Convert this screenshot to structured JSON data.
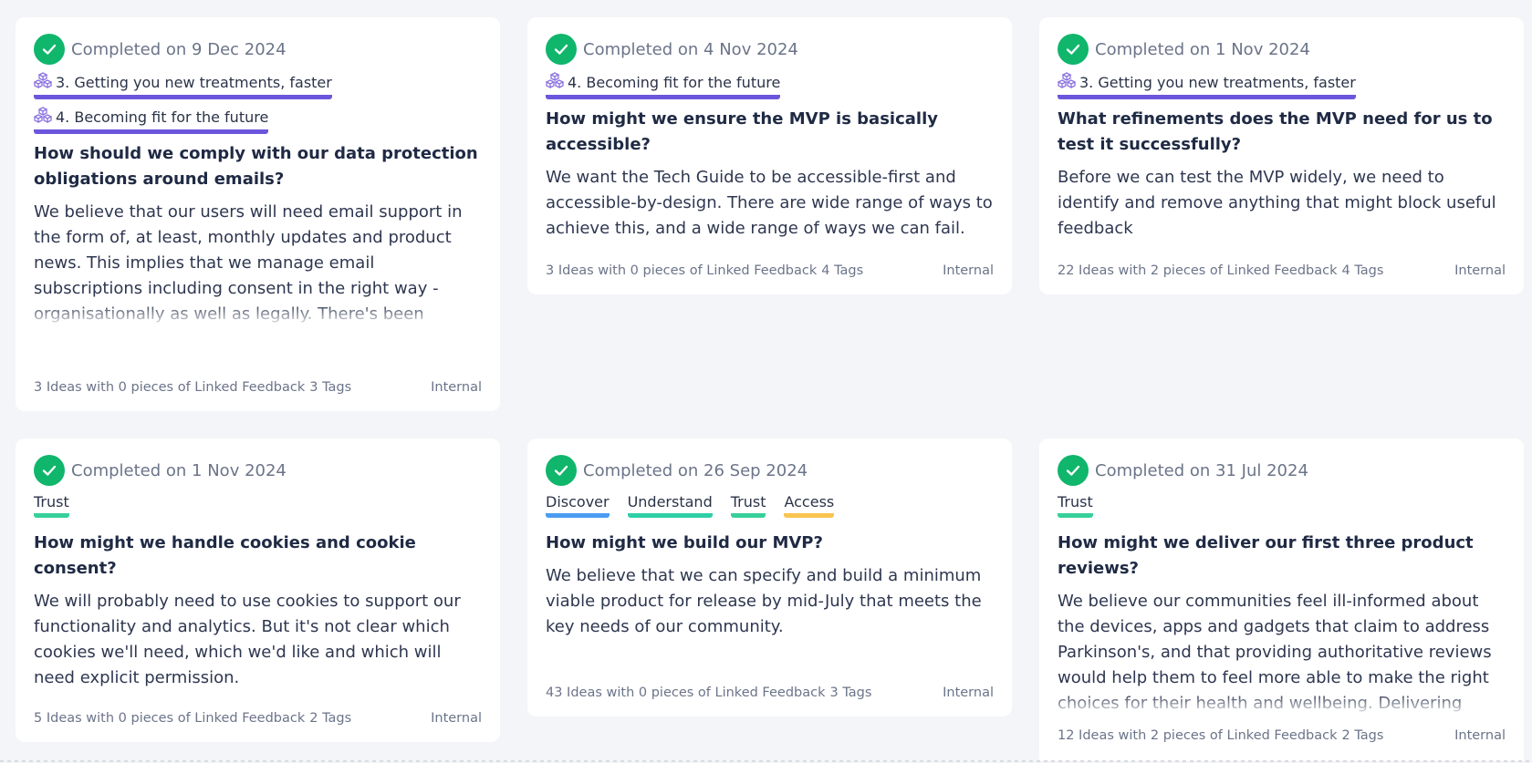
{
  "cards": [
    {
      "status": "Completed on 9 Dec 2024",
      "themes": [
        "3. Getting you new treatments, faster",
        "4. Becoming fit for the future"
      ],
      "title": "How should we comply with our data protection obligations around emails?",
      "description": "We believe that our users will need email support in the form of, at least, monthly updates and product news. This implies that we manage email subscriptions including consent in the right way - organisationally as well as legally. There's been internal recommendations about how to do",
      "ideas": "3 Ideas with 0 pieces of Linked Feedback",
      "tags": "3 Tags",
      "visibility": "Internal"
    },
    {
      "status": "Completed on 4 Nov 2024",
      "themes": [
        "4. Becoming fit for the future"
      ],
      "title": "How might we ensure the MVP is basically accessible?",
      "description": "We want the Tech Guide to be accessible-first and accessible-by-design. There are wide range of ways to achieve this, and a wide range of ways we can fail.",
      "ideas": "3 Ideas with 0 pieces of Linked Feedback",
      "tags": "4 Tags",
      "visibility": "Internal"
    },
    {
      "status": "Completed on 1 Nov 2024",
      "themes": [
        "3. Getting you new treatments, faster"
      ],
      "title": "What refinements does the MVP need for us to test it successfully?",
      "description": "Before we can test the MVP widely, we need to identify and remove anything that might block useful feedback",
      "ideas": "22 Ideas with 2 pieces of Linked Feedback",
      "tags": "4 Tags",
      "visibility": "Internal"
    },
    {
      "status": "Completed on 1 Nov 2024",
      "labels": [
        {
          "text": "Trust",
          "color": "#38d09a"
        }
      ],
      "title": "How might we handle cookies and cookie consent?",
      "description": "We will probably need to use cookies to support our functionality and analytics. But it's not clear which cookies we'll need, which we'd like and which will need explicit permission.",
      "ideas": "5 Ideas with 0 pieces of Linked Feedback",
      "tags": "2 Tags",
      "visibility": "Internal"
    },
    {
      "status": "Completed on 26 Sep 2024",
      "labels": [
        {
          "text": "Discover",
          "color": "#4a9cf0"
        },
        {
          "text": "Understand",
          "color": "#2fcfa6"
        },
        {
          "text": "Trust",
          "color": "#38d09a"
        },
        {
          "text": "Access",
          "color": "#f9c450"
        }
      ],
      "title": "How might we build our MVP?",
      "description": "We believe that we can specify and build a minimum viable product for release by mid-July that meets the key needs of our community.",
      "ideas": "43 Ideas with 0 pieces of Linked Feedback",
      "tags": "3 Tags",
      "visibility": "Internal"
    },
    {
      "status": "Completed on 31 Jul 2024",
      "labels": [
        {
          "text": "Trust",
          "color": "#38d09a"
        }
      ],
      "title": "How might we deliver our first three product reviews?",
      "description": "We believe our communities feel ill-informed about the devices, apps and gadgets that claim to address Parkinson's, and that providing authoritative reviews would help them to feel more able to make the right choices for their health and wellbeing. Delivering these reviews in quality and quantity",
      "ideas": "12 Ideas with 2 pieces of Linked Feedback",
      "tags": "2 Tags",
      "visibility": "Internal"
    }
  ]
}
